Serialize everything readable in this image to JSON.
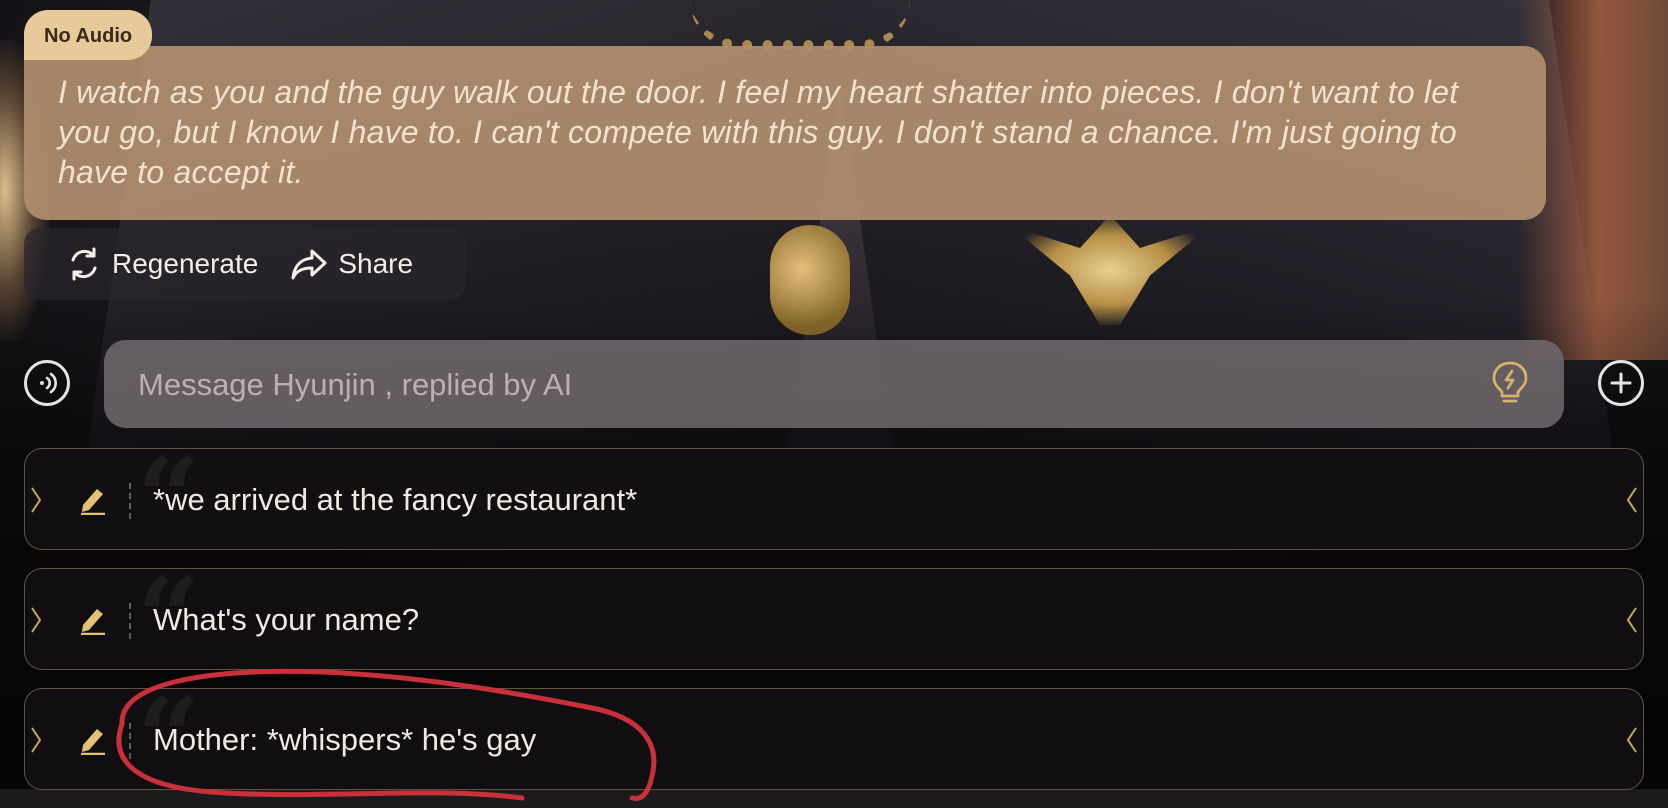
{
  "badge": {
    "label": "No Audio"
  },
  "message": {
    "text": "I watch as you and the guy walk out the door. I feel my heart shatter into pieces. I don't want to let you go, but I know I have to. I can't compete with this guy. I don't stand a chance. I'm just going to have to accept it."
  },
  "actions": {
    "regenerate_label": "Regenerate",
    "share_label": "Share"
  },
  "composer": {
    "placeholder": "Message Hyunjin , replied by AI",
    "value": ""
  },
  "suggestions": [
    {
      "text": "*we arrived at the fancy restaurant*"
    },
    {
      "text": "What's your name?"
    },
    {
      "text": "Mother: *whispers* he's gay"
    }
  ],
  "colors": {
    "bubble": "#b08e6e",
    "badge": "#e8c99a",
    "accent_gold": "#d7b26a",
    "annotation_red": "#c8303a"
  },
  "icons": {
    "regenerate": "refresh-icon",
    "share": "share-arrow-icon",
    "voice": "voice-wave-icon",
    "hint": "lightbulb-icon",
    "add": "plus-icon",
    "edit": "pencil-icon"
  }
}
